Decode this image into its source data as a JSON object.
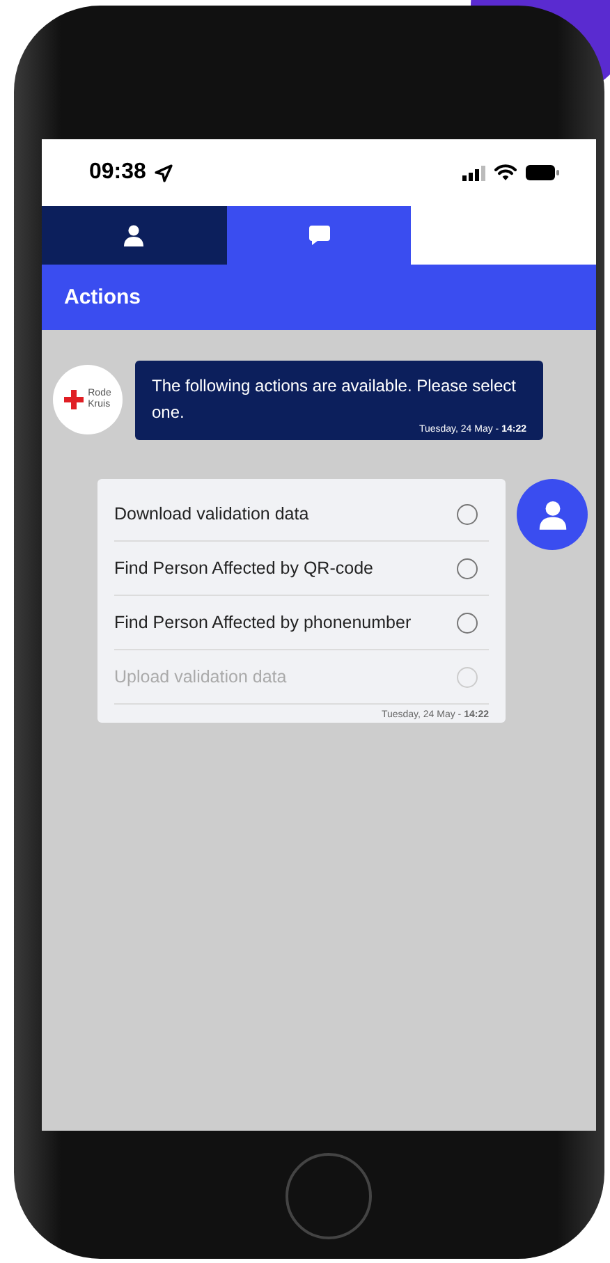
{
  "status_bar": {
    "time": "09:38"
  },
  "tabs": [
    {
      "kind": "person",
      "selected": false
    },
    {
      "kind": "chat",
      "selected": true
    },
    {
      "kind": "blank",
      "selected": false
    }
  ],
  "header": {
    "title": "Actions"
  },
  "bot_message": {
    "logo_text": [
      "Rode",
      "Kruis"
    ],
    "text": "The following actions are available. Please select one.",
    "timestamp": "Tuesday, 24 May - **14:22**"
  },
  "options_card": {
    "options": [
      {
        "label": "Download validation data",
        "selected": false,
        "disabled": false
      },
      {
        "label": "Find Person Affected by QR-code",
        "selected": false,
        "disabled": false
      },
      {
        "label": "Find Person Affected by phonenumber",
        "selected": false,
        "disabled": false
      },
      {
        "label": "Upload validation data",
        "selected": false,
        "disabled": true
      }
    ],
    "timestamp": "Tuesday, 24 May - **14:22**"
  }
}
